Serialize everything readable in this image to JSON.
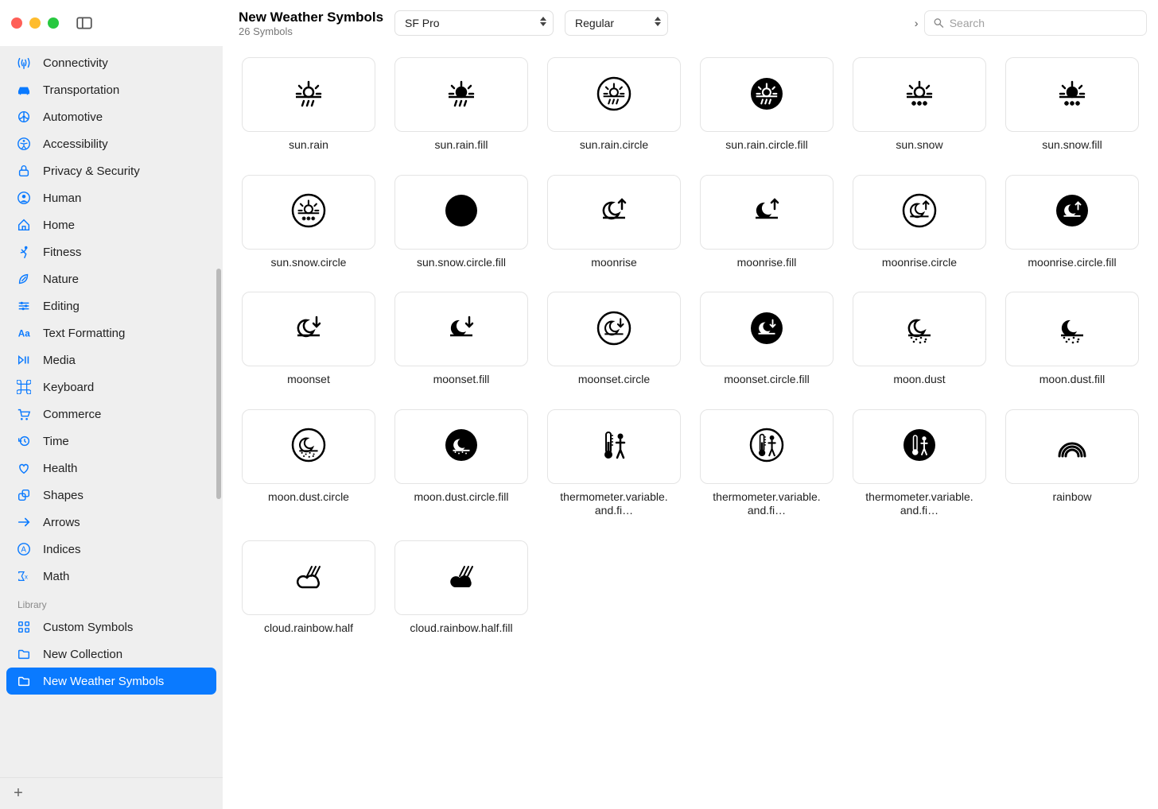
{
  "window": {
    "title": "New Weather Symbols",
    "subtitle": "26 Symbols"
  },
  "toolbar": {
    "font_select": "SF Pro",
    "weight_select": "Regular",
    "search_placeholder": "Search"
  },
  "sidebar": {
    "categories": [
      {
        "label": "Connectivity",
        "icon": "antenna"
      },
      {
        "label": "Transportation",
        "icon": "car"
      },
      {
        "label": "Automotive",
        "icon": "wheel"
      },
      {
        "label": "Accessibility",
        "icon": "accessibility"
      },
      {
        "label": "Privacy & Security",
        "icon": "lock"
      },
      {
        "label": "Human",
        "icon": "person"
      },
      {
        "label": "Home",
        "icon": "house"
      },
      {
        "label": "Fitness",
        "icon": "runner"
      },
      {
        "label": "Nature",
        "icon": "leaf"
      },
      {
        "label": "Editing",
        "icon": "sliders"
      },
      {
        "label": "Text Formatting",
        "icon": "textformat"
      },
      {
        "label": "Media",
        "icon": "playpause"
      },
      {
        "label": "Keyboard",
        "icon": "command"
      },
      {
        "label": "Commerce",
        "icon": "cart"
      },
      {
        "label": "Time",
        "icon": "clockarrow"
      },
      {
        "label": "Health",
        "icon": "heart"
      },
      {
        "label": "Shapes",
        "icon": "shapes"
      },
      {
        "label": "Arrows",
        "icon": "arrow"
      },
      {
        "label": "Indices",
        "icon": "index"
      },
      {
        "label": "Math",
        "icon": "math"
      }
    ],
    "library_header": "Library",
    "library": [
      {
        "label": "Custom Symbols",
        "icon": "grid",
        "selected": false
      },
      {
        "label": "New Collection",
        "icon": "folder",
        "selected": false
      },
      {
        "label": "New Weather Symbols",
        "icon": "folder",
        "selected": true
      }
    ]
  },
  "symbols": [
    {
      "name": "sun.rain",
      "icon": "sunrain"
    },
    {
      "name": "sun.rain.fill",
      "icon": "sunrain-fill"
    },
    {
      "name": "sun.rain.circle",
      "icon": "sunrain-circle"
    },
    {
      "name": "sun.rain.circle.fill",
      "icon": "sunrain-circlefill"
    },
    {
      "name": "sun.snow",
      "icon": "sunsnow"
    },
    {
      "name": "sun.snow.fill",
      "icon": "sunsnow-fill"
    },
    {
      "name": "sun.snow.circle",
      "icon": "sunsnow-circle"
    },
    {
      "name": "sun.snow.circle.fill",
      "icon": "sunsnow-circlefill"
    },
    {
      "name": "moonrise",
      "icon": "moonrise"
    },
    {
      "name": "moonrise.fill",
      "icon": "moonrise-fill"
    },
    {
      "name": "moonrise.circle",
      "icon": "moonrise-circle"
    },
    {
      "name": "moonrise.circle.fill",
      "icon": "moonrise-circlefill"
    },
    {
      "name": "moonset",
      "icon": "moonset"
    },
    {
      "name": "moonset.fill",
      "icon": "moonset-fill"
    },
    {
      "name": "moonset.circle",
      "icon": "moonset-circle"
    },
    {
      "name": "moonset.circle.fill",
      "icon": "moonset-circlefill"
    },
    {
      "name": "moon.dust",
      "icon": "moondust"
    },
    {
      "name": "moon.dust.fill",
      "icon": "moondust-fill"
    },
    {
      "name": "moon.dust.circle",
      "icon": "moondust-circle"
    },
    {
      "name": "moon.dust.circle.fill",
      "icon": "moondust-circlefill"
    },
    {
      "name": "thermometer.variable.and.fi…",
      "icon": "thermperson"
    },
    {
      "name": "thermometer.variable.and.fi…",
      "icon": "thermperson-circle"
    },
    {
      "name": "thermometer.variable.and.fi…",
      "icon": "thermperson-circlefill"
    },
    {
      "name": "rainbow",
      "icon": "rainbow"
    },
    {
      "name": "cloud.rainbow.half",
      "icon": "cloudrainbow"
    },
    {
      "name": "cloud.rainbow.half.fill",
      "icon": "cloudrainbow-fill"
    }
  ]
}
